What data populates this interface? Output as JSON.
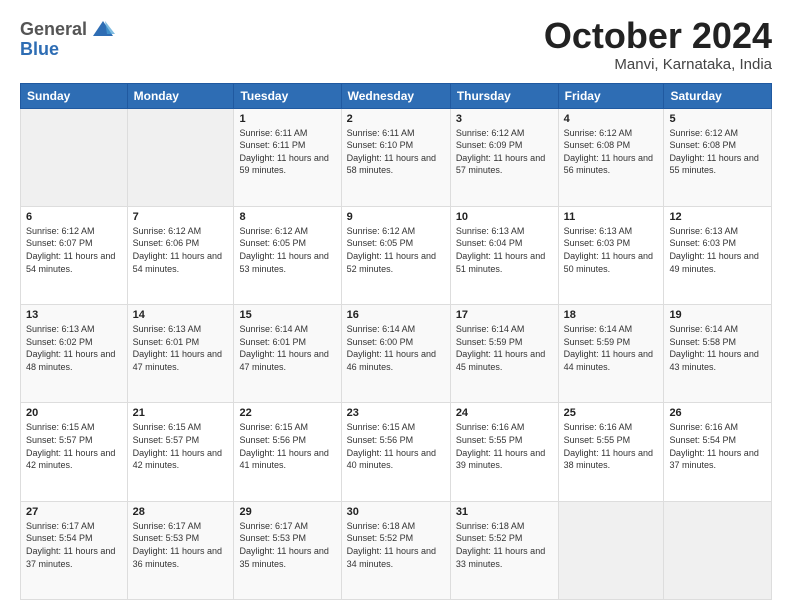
{
  "header": {
    "logo": {
      "general": "General",
      "blue": "Blue"
    },
    "title": "October 2024",
    "location": "Manvi, Karnataka, India"
  },
  "days_of_week": [
    "Sunday",
    "Monday",
    "Tuesday",
    "Wednesday",
    "Thursday",
    "Friday",
    "Saturday"
  ],
  "weeks": [
    [
      null,
      null,
      {
        "day": "1",
        "sunrise": "6:11 AM",
        "sunset": "6:11 PM",
        "daylight": "11 hours and 59 minutes."
      },
      {
        "day": "2",
        "sunrise": "6:11 AM",
        "sunset": "6:10 PM",
        "daylight": "11 hours and 58 minutes."
      },
      {
        "day": "3",
        "sunrise": "6:12 AM",
        "sunset": "6:09 PM",
        "daylight": "11 hours and 57 minutes."
      },
      {
        "day": "4",
        "sunrise": "6:12 AM",
        "sunset": "6:08 PM",
        "daylight": "11 hours and 56 minutes."
      },
      {
        "day": "5",
        "sunrise": "6:12 AM",
        "sunset": "6:08 PM",
        "daylight": "11 hours and 55 minutes."
      }
    ],
    [
      {
        "day": "6",
        "sunrise": "6:12 AM",
        "sunset": "6:07 PM",
        "daylight": "11 hours and 54 minutes."
      },
      {
        "day": "7",
        "sunrise": "6:12 AM",
        "sunset": "6:06 PM",
        "daylight": "11 hours and 54 minutes."
      },
      {
        "day": "8",
        "sunrise": "6:12 AM",
        "sunset": "6:05 PM",
        "daylight": "11 hours and 53 minutes."
      },
      {
        "day": "9",
        "sunrise": "6:12 AM",
        "sunset": "6:05 PM",
        "daylight": "11 hours and 52 minutes."
      },
      {
        "day": "10",
        "sunrise": "6:13 AM",
        "sunset": "6:04 PM",
        "daylight": "11 hours and 51 minutes."
      },
      {
        "day": "11",
        "sunrise": "6:13 AM",
        "sunset": "6:03 PM",
        "daylight": "11 hours and 50 minutes."
      },
      {
        "day": "12",
        "sunrise": "6:13 AM",
        "sunset": "6:03 PM",
        "daylight": "11 hours and 49 minutes."
      }
    ],
    [
      {
        "day": "13",
        "sunrise": "6:13 AM",
        "sunset": "6:02 PM",
        "daylight": "11 hours and 48 minutes."
      },
      {
        "day": "14",
        "sunrise": "6:13 AM",
        "sunset": "6:01 PM",
        "daylight": "11 hours and 47 minutes."
      },
      {
        "day": "15",
        "sunrise": "6:14 AM",
        "sunset": "6:01 PM",
        "daylight": "11 hours and 47 minutes."
      },
      {
        "day": "16",
        "sunrise": "6:14 AM",
        "sunset": "6:00 PM",
        "daylight": "11 hours and 46 minutes."
      },
      {
        "day": "17",
        "sunrise": "6:14 AM",
        "sunset": "5:59 PM",
        "daylight": "11 hours and 45 minutes."
      },
      {
        "day": "18",
        "sunrise": "6:14 AM",
        "sunset": "5:59 PM",
        "daylight": "11 hours and 44 minutes."
      },
      {
        "day": "19",
        "sunrise": "6:14 AM",
        "sunset": "5:58 PM",
        "daylight": "11 hours and 43 minutes."
      }
    ],
    [
      {
        "day": "20",
        "sunrise": "6:15 AM",
        "sunset": "5:57 PM",
        "daylight": "11 hours and 42 minutes."
      },
      {
        "day": "21",
        "sunrise": "6:15 AM",
        "sunset": "5:57 PM",
        "daylight": "11 hours and 42 minutes."
      },
      {
        "day": "22",
        "sunrise": "6:15 AM",
        "sunset": "5:56 PM",
        "daylight": "11 hours and 41 minutes."
      },
      {
        "day": "23",
        "sunrise": "6:15 AM",
        "sunset": "5:56 PM",
        "daylight": "11 hours and 40 minutes."
      },
      {
        "day": "24",
        "sunrise": "6:16 AM",
        "sunset": "5:55 PM",
        "daylight": "11 hours and 39 minutes."
      },
      {
        "day": "25",
        "sunrise": "6:16 AM",
        "sunset": "5:55 PM",
        "daylight": "11 hours and 38 minutes."
      },
      {
        "day": "26",
        "sunrise": "6:16 AM",
        "sunset": "5:54 PM",
        "daylight": "11 hours and 37 minutes."
      }
    ],
    [
      {
        "day": "27",
        "sunrise": "6:17 AM",
        "sunset": "5:54 PM",
        "daylight": "11 hours and 37 minutes."
      },
      {
        "day": "28",
        "sunrise": "6:17 AM",
        "sunset": "5:53 PM",
        "daylight": "11 hours and 36 minutes."
      },
      {
        "day": "29",
        "sunrise": "6:17 AM",
        "sunset": "5:53 PM",
        "daylight": "11 hours and 35 minutes."
      },
      {
        "day": "30",
        "sunrise": "6:18 AM",
        "sunset": "5:52 PM",
        "daylight": "11 hours and 34 minutes."
      },
      {
        "day": "31",
        "sunrise": "6:18 AM",
        "sunset": "5:52 PM",
        "daylight": "11 hours and 33 minutes."
      },
      null,
      null
    ]
  ]
}
